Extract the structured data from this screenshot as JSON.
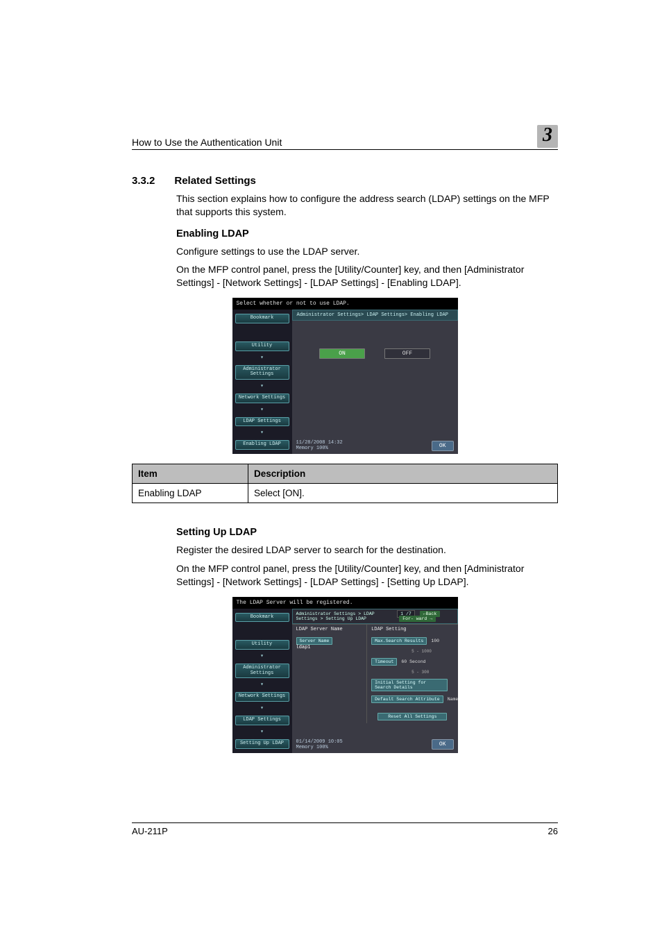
{
  "header": {
    "title": "How to Use the Authentication Unit",
    "chapter_number": "3"
  },
  "section": {
    "number": "3.3.2",
    "title": "Related Settings",
    "intro": "This section explains how to configure the address search (LDAP) settings on the MFP that supports this system."
  },
  "enabling": {
    "heading": "Enabling LDAP",
    "line1": "Configure settings to use the LDAP server.",
    "line2": "On the MFP control panel, press the [Utility/Counter] key, and then [Administrator Settings] - [Network Settings] - [LDAP Settings] - [Enabling LDAP]."
  },
  "mfp1": {
    "top": "Select whether or not to use LDAP.",
    "bookmark": "Bookmark",
    "side": [
      "Utility",
      "Administrator Settings",
      "Network Settings",
      "LDAP Settings",
      "Enabling LDAP"
    ],
    "crumb": "Administrator Settings> LDAP Settings> Enabling LDAP",
    "on": "ON",
    "off": "OFF",
    "datetime": "11/28/2008  14:32",
    "memory": "Memory      100%",
    "ok": "OK"
  },
  "table1": {
    "hdr_item": "Item",
    "hdr_desc": "Description",
    "row_item": "Enabling LDAP",
    "row_desc": "Select [ON]."
  },
  "setup": {
    "heading": "Setting Up LDAP",
    "line1": "Register the desired LDAP server to search for the destination.",
    "line2": "On the MFP control panel, press the [Utility/Counter] key, and then [Administrator Settings] - [Network Settings] - [LDAP Settings] - [Setting Up LDAP]."
  },
  "mfp2": {
    "top": "The LDAP Server will be registered.",
    "bookmark": "Bookmark",
    "side": [
      "Utility",
      "Administrator Settings",
      "Network Settings",
      "LDAP Settings",
      "Setting Up LDAP"
    ],
    "crumb": "Administrator Settings > LDAP Settings > Setting Up LDAP",
    "page": "1 /7",
    "back": "←Back",
    "forward": "For- ward →",
    "col_left": "LDAP Server Name",
    "col_right": "LDAP Setting",
    "server_name_label": "Server Name",
    "server_name_value": "ldap1",
    "max_label": "Max.Search Results",
    "max_val": "100",
    "max_range": "5  -  1000",
    "timeout_label": "Timeout",
    "timeout_val": "60  Second",
    "timeout_range": "5  -   300",
    "initial_label": "Initial Setting for Search Details",
    "default_label": "Default Search Attribute",
    "default_val": "Name",
    "reset": "Reset All Settings",
    "datetime": "01/14/2009  10:05",
    "memory": "Memory      100%",
    "ok": "OK"
  },
  "footer": {
    "model": "AU-211P",
    "page_no": "26"
  }
}
